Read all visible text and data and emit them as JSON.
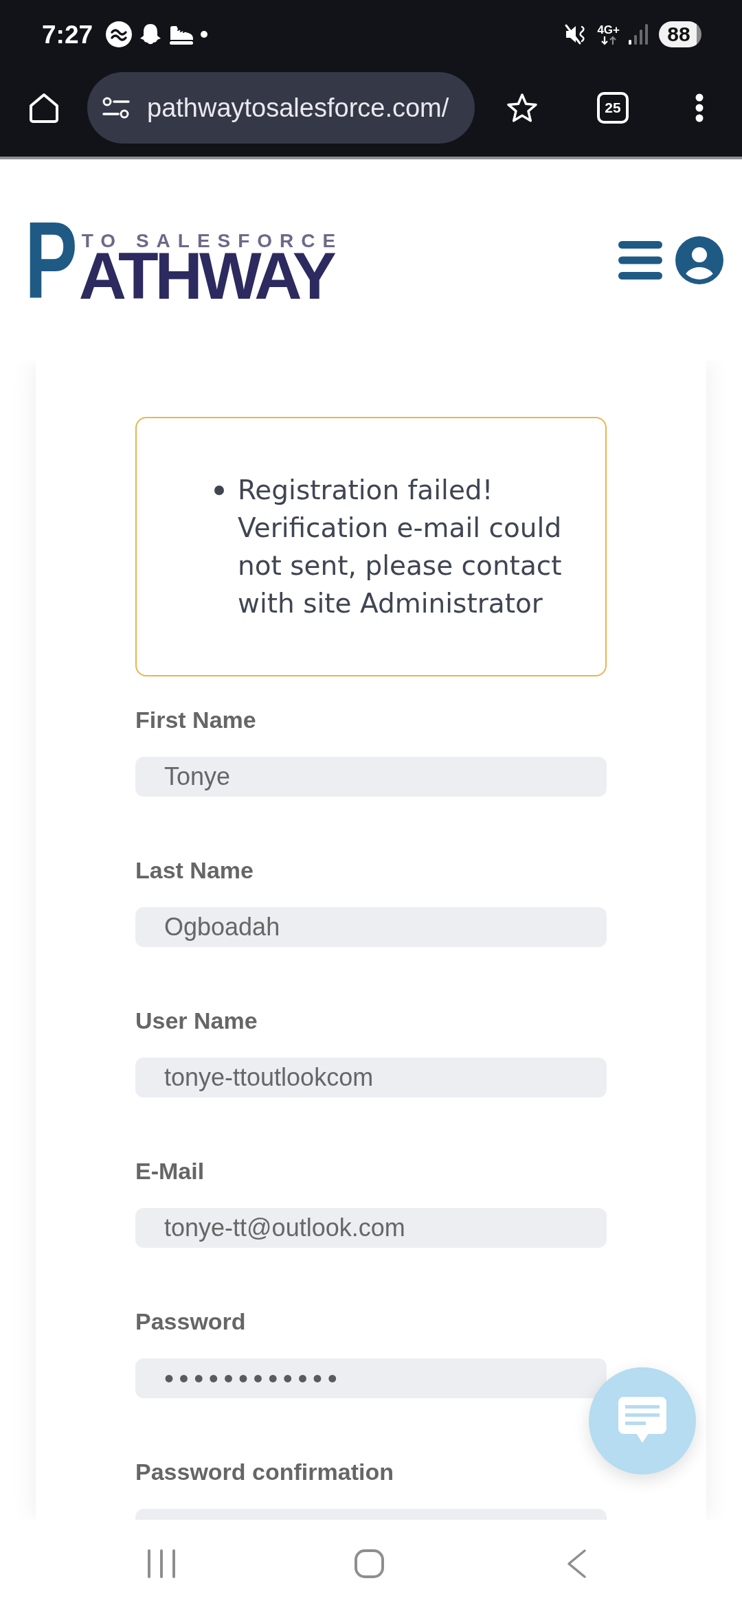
{
  "status_bar": {
    "time": "7:27",
    "network": "4G+",
    "battery": "88"
  },
  "browser_toolbar": {
    "url": "pathwaytosalesforce.com/",
    "tab_count": "25"
  },
  "site_header": {
    "logo": {
      "initial": "P",
      "tagline": "TO SALESFORCE",
      "wordmark": "ATHWAY"
    }
  },
  "alert": {
    "messages": [
      "Registration failed! Verification e-mail could not sent, please contact with site Administrator"
    ]
  },
  "form": {
    "fields": [
      {
        "label": "First Name",
        "kind": "text",
        "value": "Tonye"
      },
      {
        "label": "Last Name",
        "kind": "text",
        "value": "Ogboadah"
      },
      {
        "label": "User Name",
        "kind": "text",
        "value": "tonye-ttoutlookcom"
      },
      {
        "label": "E-Mail",
        "kind": "text",
        "value": "tonye-tt@outlook.com"
      },
      {
        "label": "Password",
        "kind": "password",
        "value": "••••••••••••"
      },
      {
        "label": "Password confirmation",
        "kind": "password"
      }
    ]
  }
}
